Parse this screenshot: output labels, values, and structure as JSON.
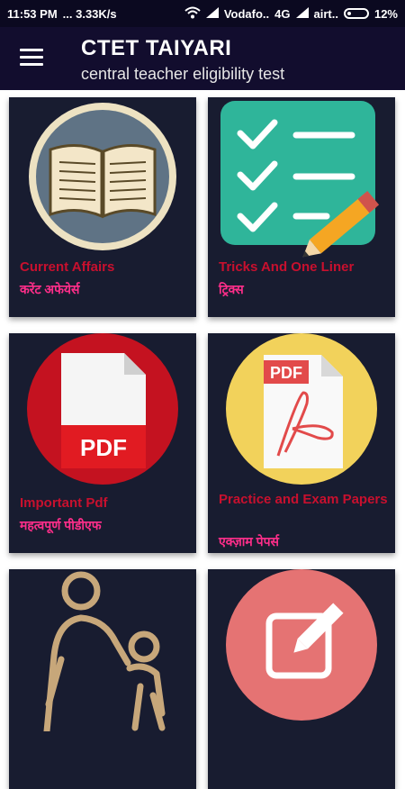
{
  "status_bar": {
    "time": "11:53 PM",
    "speed": "... 3.33K/s",
    "carrier1": "Vodafo..",
    "network": "4G",
    "carrier2": "airt..",
    "battery": "12%"
  },
  "toolbar": {
    "title": "CTET TAIYARI",
    "subtitle": "central teacher eligibility test"
  },
  "cards": [
    {
      "title": "Current Affairs",
      "subtitle": "करेंट अफेयेर्स",
      "icon": "book-icon"
    },
    {
      "title": "Tricks And One Liner",
      "subtitle": "ट्रिक्स",
      "icon": "checklist-icon"
    },
    {
      "title": "Important Pdf",
      "subtitle": "महत्वपूर्ण पीडीएफ",
      "icon": "pdf-icon"
    },
    {
      "title": "Practice and Exam Papers",
      "subtitle": "एक्ज़ाम पेपर्स",
      "icon": "pdf-file-icon"
    },
    {
      "title": "",
      "subtitle": "",
      "icon": "parent-child-icon"
    },
    {
      "title": "",
      "subtitle": "",
      "icon": "edit-icon"
    }
  ],
  "colors": {
    "toolbar": "#120d2e",
    "card": "#181c30",
    "title": "#c8102e",
    "subtitle": "#ff2e8a"
  }
}
